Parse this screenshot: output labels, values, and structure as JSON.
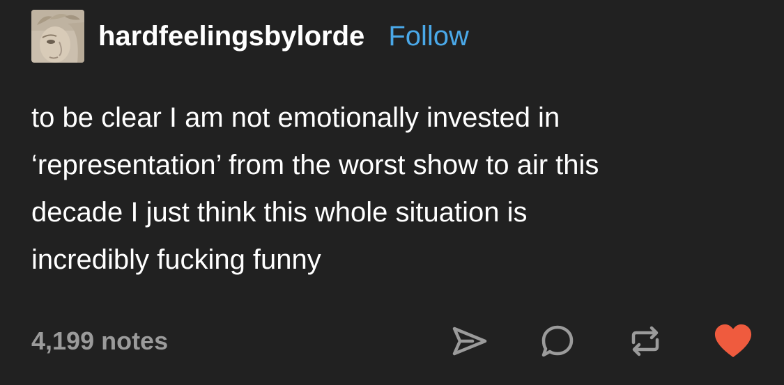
{
  "post": {
    "username": "hardfeelingsbylorde",
    "follow_label": "Follow",
    "body_lines": [
      "to be clear I am not emotionally invested in",
      "‘representation’ from the worst show to air this",
      "decade I just think this whole situation is",
      "incredibly fucking funny"
    ],
    "notes": "4,199 notes"
  },
  "icons": {
    "avatar": "statue-avatar",
    "share": "share-icon",
    "reply": "reply-icon",
    "reblog": "reblog-icon",
    "like": "heart-icon"
  },
  "colors": {
    "background": "#212121",
    "follow": "#4aa8e8",
    "notes": "#9b9b9b",
    "like": "#ef5b3e"
  }
}
